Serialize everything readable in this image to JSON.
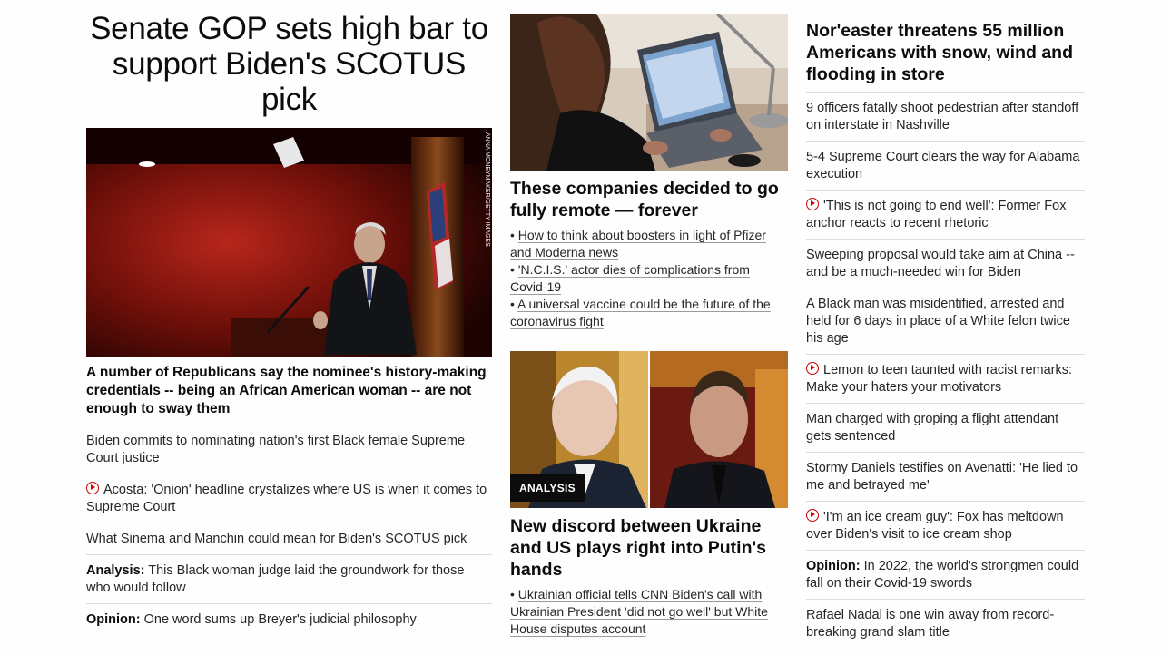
{
  "left_column": {
    "headline": "Senate GOP sets high bar to support Biden's SCOTUS pick",
    "image_credit": "ANNA MONEYMAKER/GETTY IMAGES",
    "subheadline": "A number of Republicans say the nominee's history-making credentials -- being an African American woman -- are not enough to sway them",
    "items": [
      {
        "prefix": "",
        "text": "Biden commits to nominating nation's first Black female Supreme Court justice",
        "video": false
      },
      {
        "prefix": "",
        "text": "Acosta: 'Onion' headline crystalizes where US is when it comes to Supreme Court",
        "video": true
      },
      {
        "prefix": "",
        "text": "What Sinema and Manchin could mean for Biden's SCOTUS pick",
        "video": false
      },
      {
        "prefix": "Analysis:",
        "text": " This Black woman judge laid the groundwork for those who would follow",
        "video": false
      },
      {
        "prefix": "Opinion:",
        "text": " One word sums up Breyer's judicial philosophy",
        "video": false
      }
    ]
  },
  "middle_column": {
    "story1": {
      "headline": "These companies decided to go fully remote — forever",
      "bullets": [
        "How to think about boosters in light of Pfizer and Moderna news",
        "'N.C.I.S.' actor dies of complications from Covid-19",
        "A universal vaccine could be the future of the coronavirus fight"
      ]
    },
    "story2": {
      "badge": "ANALYSIS",
      "headline": "New discord between Ukraine and US plays right into Putin's hands",
      "bullets": [
        "Ukrainian official tells CNN Biden's call with Ukrainian President 'did not go well' but White House disputes account"
      ]
    }
  },
  "right_column": {
    "headline": "Nor'easter threatens 55 million Americans with snow, wind and flooding in store",
    "items": [
      {
        "prefix": "",
        "text": "9 officers fatally shoot pedestrian after standoff on interstate in Nashville",
        "video": false
      },
      {
        "prefix": "",
        "text": "5-4 Supreme Court clears the way for Alabama execution",
        "video": false
      },
      {
        "prefix": "",
        "text": "'This is not going to end well': Former Fox anchor reacts to recent rhetoric",
        "video": true
      },
      {
        "prefix": "",
        "text": "Sweeping proposal would take aim at China -- and be a much-needed win for Biden",
        "video": false
      },
      {
        "prefix": "",
        "text": "A Black man was misidentified, arrested and held for 6 days in place of a White felon twice his age",
        "video": false
      },
      {
        "prefix": "",
        "text": "Lemon to teen taunted with racist remarks: Make your haters your motivators",
        "video": true
      },
      {
        "prefix": "",
        "text": "Man charged with groping a flight attendant gets sentenced",
        "video": false
      },
      {
        "prefix": "",
        "text": "Stormy Daniels testifies on Avenatti: 'He lied to me and betrayed me'",
        "video": false
      },
      {
        "prefix": "",
        "text": "'I'm an ice cream guy': Fox has meltdown over Biden's visit to ice cream shop",
        "video": true
      },
      {
        "prefix": "Opinion:",
        "text": " In 2022, the world's strongmen could fall on their Covid-19 swords",
        "video": false
      },
      {
        "prefix": "",
        "text": "Rafael Nadal is one win away from record-breaking grand slam title",
        "video": false
      }
    ]
  },
  "colors": {
    "video_icon": "#cc0000",
    "divider": "#dcdcdc",
    "text": "#0c0c0c"
  }
}
